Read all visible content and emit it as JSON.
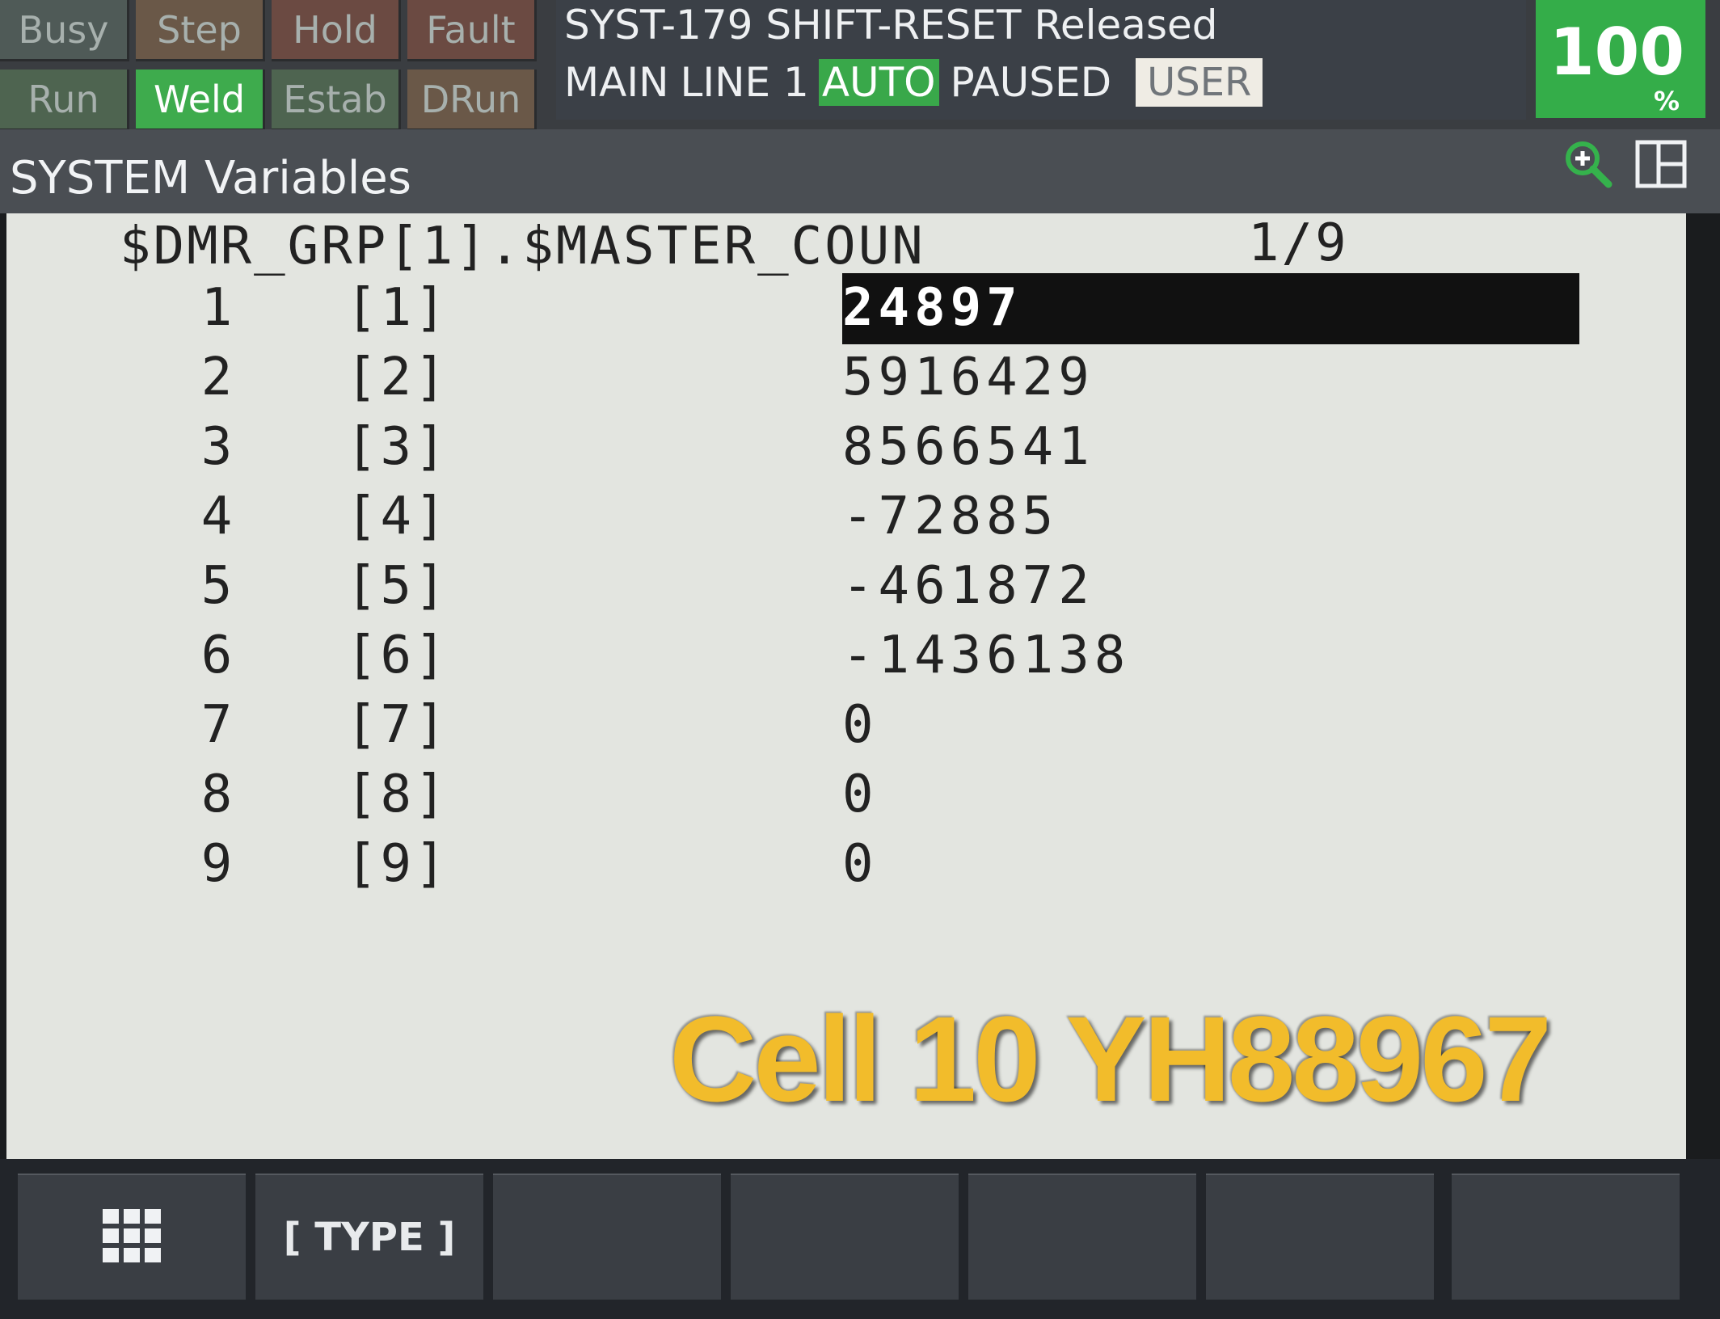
{
  "status_leds": {
    "row1": [
      {
        "label": "Busy",
        "state": "off"
      },
      {
        "label": "Step",
        "state": "off"
      },
      {
        "label": "Hold",
        "state": "off"
      },
      {
        "label": "Fault",
        "state": "off"
      }
    ],
    "row2": [
      {
        "label": "Run",
        "state": "off"
      },
      {
        "label": "Weld",
        "state": "on"
      },
      {
        "label": "Estab",
        "state": "off"
      },
      {
        "label": "DRun",
        "state": "off"
      }
    ]
  },
  "status": {
    "alarm_message": "SYST-179 SHIFT-RESET Released",
    "program": "MAIN",
    "line": "LINE 1",
    "mode": "AUTO",
    "state": "PAUSED",
    "user_badge": "USER"
  },
  "override": {
    "value": "100",
    "unit": "%"
  },
  "screen": {
    "title": "SYSTEM Variables",
    "variable": "$DMR_GRP[1].$MASTER_COUN",
    "page": "1/9",
    "icons": {
      "zoom": "zoom-in-icon",
      "layout": "split-layout-icon"
    }
  },
  "rows": [
    {
      "num": "1",
      "index": "[1]",
      "value": "24897"
    },
    {
      "num": "2",
      "index": "[2]",
      "value": "5916429"
    },
    {
      "num": "3",
      "index": "[3]",
      "value": "8566541"
    },
    {
      "num": "4",
      "index": "[4]",
      "value": "-72885"
    },
    {
      "num": "5",
      "index": "[5]",
      "value": "-461872"
    },
    {
      "num": "6",
      "index": "[6]",
      "value": "-1436138"
    },
    {
      "num": "7",
      "index": "[7]",
      "value": "0"
    },
    {
      "num": "8",
      "index": "[8]",
      "value": "0"
    },
    {
      "num": "9",
      "index": "[9]",
      "value": "0"
    }
  ],
  "selected_row": 1,
  "overlay_caption": "Cell 10 YH88967",
  "function_keys": [
    {
      "label": "",
      "icon": "grid-menu-icon"
    },
    {
      "label": "[ TYPE ]"
    },
    {
      "label": ""
    },
    {
      "label": ""
    },
    {
      "label": ""
    },
    {
      "label": ""
    },
    {
      "label": ""
    }
  ],
  "colors": {
    "active_green": "#3eab4d",
    "caption_yellow": "#f2bc2b",
    "screen_bg": "#e3e5e0",
    "cursor": "#111111"
  }
}
